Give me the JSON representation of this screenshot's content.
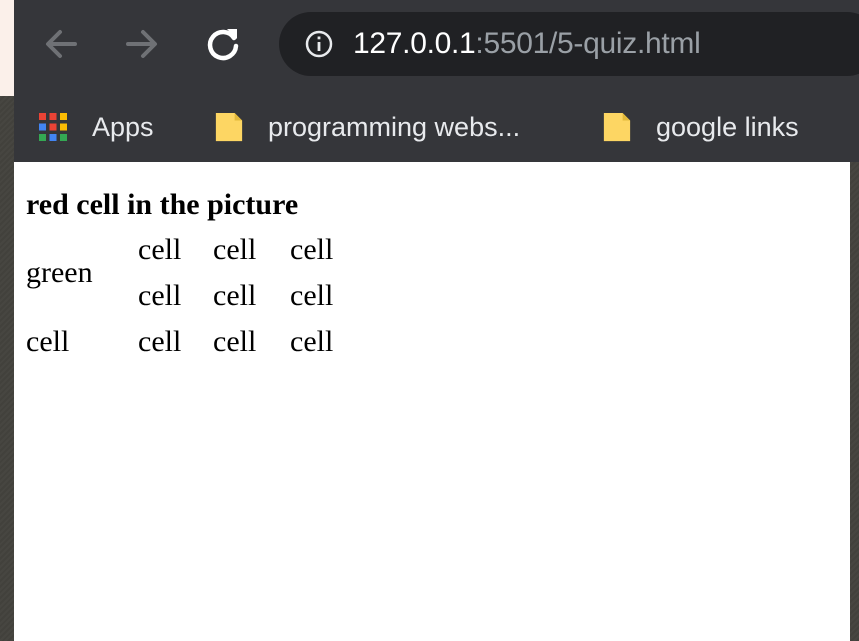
{
  "address_bar": {
    "host": "127.0.0.1",
    "rest": ":5501/5-quiz.html"
  },
  "bookmarks": [
    {
      "label": "Apps",
      "icon": "apps-grid-icon"
    },
    {
      "label": "programming webs...",
      "icon": "folder-icon"
    },
    {
      "label": "google links",
      "icon": "folder-icon"
    }
  ],
  "page": {
    "heading": "red cell in the picture",
    "table": {
      "rows": [
        [
          "green",
          "cell",
          "cell",
          "cell"
        ],
        [
          "",
          "cell",
          "cell",
          "cell"
        ],
        [
          "cell",
          "cell",
          "cell",
          "cell"
        ]
      ]
    }
  },
  "colors": {
    "toolbar": "#35363a",
    "omnibox": "#202124",
    "folder": "#fdd663",
    "page_bg": "#ffffff"
  }
}
